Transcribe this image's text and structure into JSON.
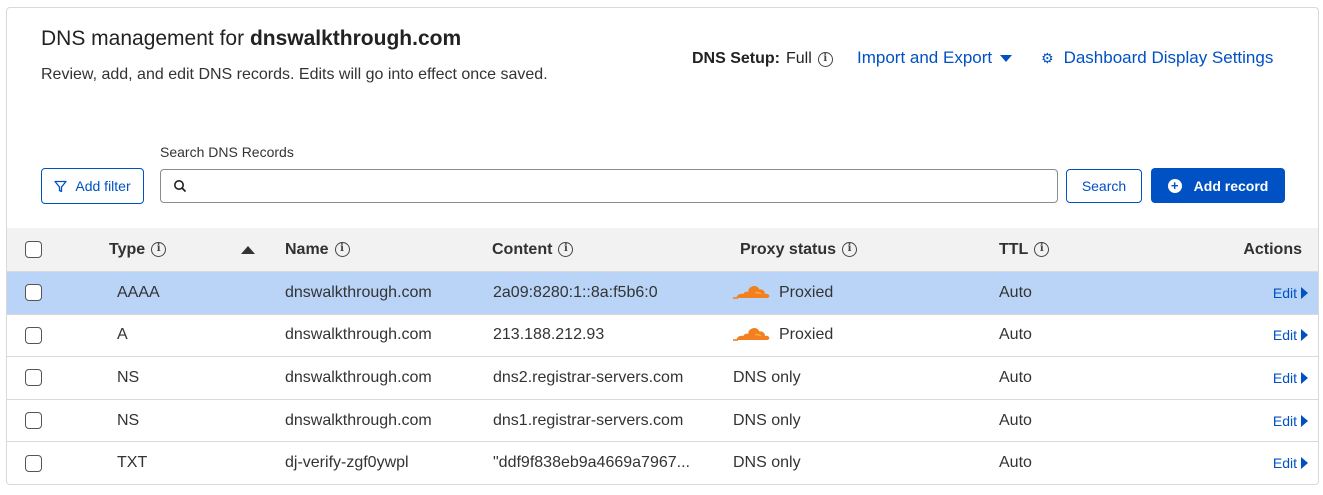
{
  "header": {
    "title_prefix": "DNS management for ",
    "title_domain": "dnswalkthrough.com",
    "description": "Review, add, and edit DNS records. Edits will go into effect once saved.",
    "setup_label": "DNS Setup:",
    "setup_value": "Full",
    "import_export_label": "Import and Export",
    "dashboard_settings_label": "Dashboard Display Settings"
  },
  "toolbar": {
    "add_filter_label": "Add filter",
    "search_label": "Search DNS Records",
    "search_value": "",
    "search_placeholder": "",
    "search_button_label": "Search",
    "add_record_label": "Add record"
  },
  "table": {
    "columns": {
      "type": "Type",
      "name": "Name",
      "content": "Content",
      "proxy": "Proxy status",
      "ttl": "TTL",
      "actions": "Actions"
    },
    "rows": [
      {
        "type": "AAAA",
        "name": "dnswalkthrough.com",
        "content": "2a09:8280:1::8a:f5b6:0",
        "proxy": "Proxied",
        "proxied": true,
        "ttl": "Auto",
        "action": "Edit",
        "selected": true
      },
      {
        "type": "A",
        "name": "dnswalkthrough.com",
        "content": "213.188.212.93",
        "proxy": "Proxied",
        "proxied": true,
        "ttl": "Auto",
        "action": "Edit",
        "selected": false
      },
      {
        "type": "NS",
        "name": "dnswalkthrough.com",
        "content": "dns2.registrar-servers.com",
        "proxy": "DNS only",
        "proxied": false,
        "ttl": "Auto",
        "action": "Edit",
        "selected": false
      },
      {
        "type": "NS",
        "name": "dnswalkthrough.com",
        "content": "dns1.registrar-servers.com",
        "proxy": "DNS only",
        "proxied": false,
        "ttl": "Auto",
        "action": "Edit",
        "selected": false
      },
      {
        "type": "TXT",
        "name": "dj-verify-zgf0ywpl",
        "content": "\"ddf9f838eb9a4669a7967...",
        "proxy": "DNS only",
        "proxied": false,
        "ttl": "Auto",
        "action": "Edit",
        "selected": false
      }
    ]
  },
  "colors": {
    "accent": "#0051c3",
    "selected_row": "#b9d4f7",
    "cloud_orange": "#f38020"
  },
  "icons": [
    "info-icon",
    "chevron-down-icon",
    "gear-icon",
    "filter-icon",
    "search-icon",
    "plus-circle-icon",
    "sort-ascending-icon",
    "cloud-icon",
    "chevron-right-icon",
    "checkbox-icon"
  ]
}
